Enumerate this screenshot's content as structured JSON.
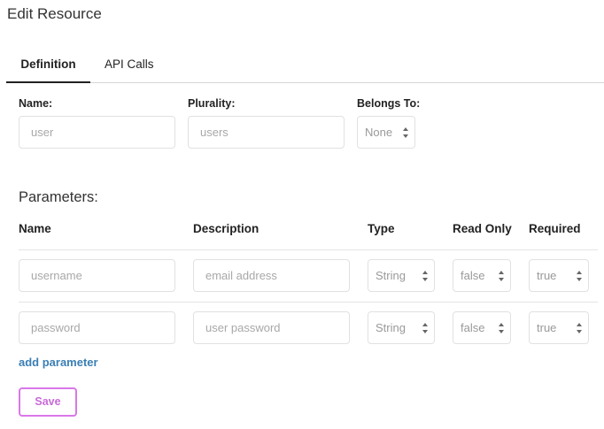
{
  "page_title": "Edit Resource",
  "tabs": [
    {
      "label": "Definition",
      "active": true
    },
    {
      "label": "API Calls",
      "active": false
    }
  ],
  "resource": {
    "name_label": "Name:",
    "name_placeholder": "user",
    "plurality_label": "Plurality:",
    "plurality_placeholder": "users",
    "belongs_to_label": "Belongs To:",
    "belongs_to_value": "None"
  },
  "parameters": {
    "title": "Parameters:",
    "headers": {
      "name": "Name",
      "description": "Description",
      "type": "Type",
      "read_only": "Read Only",
      "required": "Required"
    },
    "rows": [
      {
        "name_placeholder": "username",
        "description_placeholder": "email address",
        "type": "String",
        "read_only": "false",
        "required": "true"
      },
      {
        "name_placeholder": "password",
        "description_placeholder": "user password",
        "type": "String",
        "read_only": "false",
        "required": "true"
      }
    ],
    "add_label": "add parameter"
  },
  "save_label": "Save",
  "colors": {
    "accent_link": "#3a7fb5",
    "save_border": "#d977e8",
    "save_text": "#c86ad8"
  }
}
